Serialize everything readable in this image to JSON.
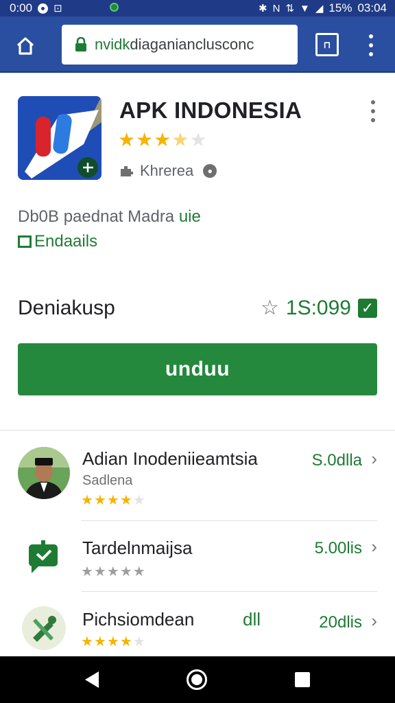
{
  "status_bar": {
    "time_left": "0:00",
    "battery": "15%",
    "time_right": "03:04"
  },
  "browser": {
    "url_host": "nvidk",
    "url_path": "diaganianclusconc"
  },
  "app": {
    "title": "APK INDONESIA",
    "rating": 3.5,
    "rating_max": 5,
    "developer": "Khrerea",
    "description": "Db0B paednat Madra",
    "description_link": "uie",
    "details_link": "Endaails",
    "section_title": "Deniakusp",
    "download_count": "1S:099",
    "download_button": "unduu",
    "accent_color": "#24893d",
    "toolbar_color": "#2a4ea0"
  },
  "related": [
    {
      "name": "Adian Inodeniieamtsia",
      "subtitle": "Sadlena",
      "price": "S.0dlla",
      "rating": 4,
      "rating_max": 5,
      "icon": "person-avatar"
    },
    {
      "name": "Tardelnmaijsa",
      "subtitle": "",
      "price": "5.00lis",
      "rating": 0,
      "rating_max": 5,
      "icon": "chat-check-icon"
    },
    {
      "name": "Pichsiomdean",
      "subtitle": "",
      "extra": "dll",
      "price": "20dlis",
      "rating": 4,
      "rating_max": 5,
      "icon": "tools-icon"
    }
  ]
}
